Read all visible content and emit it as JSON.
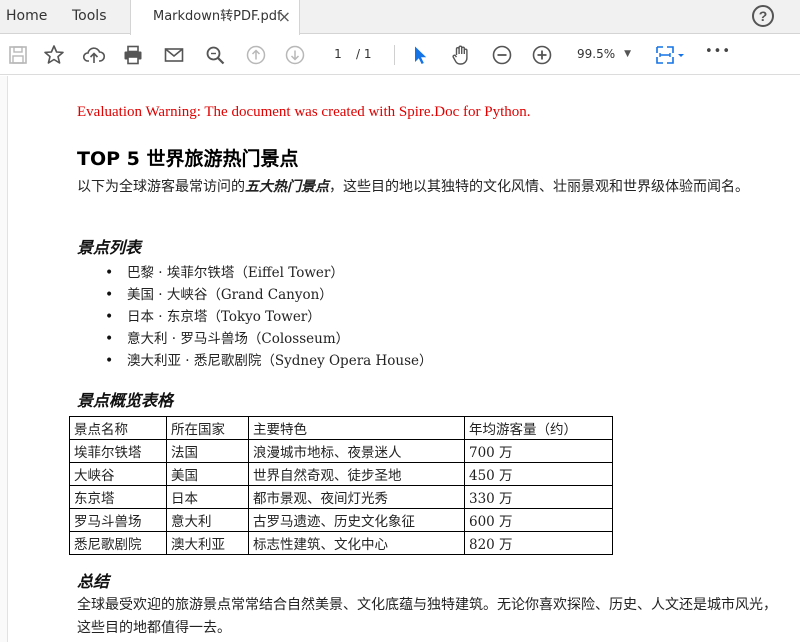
{
  "tabs": {
    "home": "Home",
    "tools": "Tools",
    "document": "Markdown转PDF.pdf",
    "close": "×"
  },
  "help": "?",
  "toolbar": {
    "page_current": "1",
    "page_sep": "/ 1",
    "zoom": "99.5%",
    "zoom_caret": "▼",
    "more": "•••"
  },
  "document": {
    "warning": "Evaluation Warning: The document was created with Spire.Doc for Python.",
    "title": "TOP 5 世界旅游热门景点",
    "intro_pre": "以下为全球游客最常访问的",
    "intro_em": "五大热门景点",
    "intro_post": "，这些目的地以其独特的文化风情、壮丽景观和世界级体验而闻名。",
    "list_heading": "景点列表",
    "list_items": [
      "巴黎 · 埃菲尔铁塔（Eiffel Tower）",
      "美国 · 大峡谷（Grand Canyon）",
      "日本 · 东京塔（Tokyo Tower）",
      "意大利 · 罗马斗兽场（Colosseum）",
      "澳大利亚 · 悉尼歌剧院（Sydney Opera House）"
    ],
    "table_heading": "景点概览表格",
    "table": {
      "headers": [
        "景点名称",
        "所在国家",
        "主要特色",
        "年均游客量（约）"
      ],
      "rows": [
        [
          "埃菲尔铁塔",
          "法国",
          "浪漫城市地标、夜景迷人",
          "700 万"
        ],
        [
          "大峡谷",
          "美国",
          "世界自然奇观、徒步圣地",
          "450 万"
        ],
        [
          "东京塔",
          "日本",
          "都市景观、夜间灯光秀",
          "330 万"
        ],
        [
          "罗马斗兽场",
          "意大利",
          "古罗马遗迹、历史文化象征",
          "600 万"
        ],
        [
          "悉尼歌剧院",
          "澳大利亚",
          "标志性建筑、文化中心",
          "820 万"
        ]
      ]
    },
    "summary_heading": "总结",
    "summary": "全球最受欢迎的旅游景点常常结合自然美景、文化底蕴与独特建筑。无论你喜欢探险、历史、人文还是城市风光，这些目的地都值得一去。"
  },
  "colors": {
    "warning": "#e00000",
    "select_tool": "#1473e6",
    "icon": "#555555"
  },
  "icons": [
    "save-icon",
    "star-icon",
    "upload-icon",
    "print-icon",
    "mail-icon",
    "zoom-search-icon",
    "page-up-icon",
    "page-down-icon",
    "select-arrow-icon",
    "hand-icon",
    "zoom-out-icon",
    "zoom-in-icon",
    "fit-page-icon",
    "more-icon",
    "help-icon"
  ]
}
